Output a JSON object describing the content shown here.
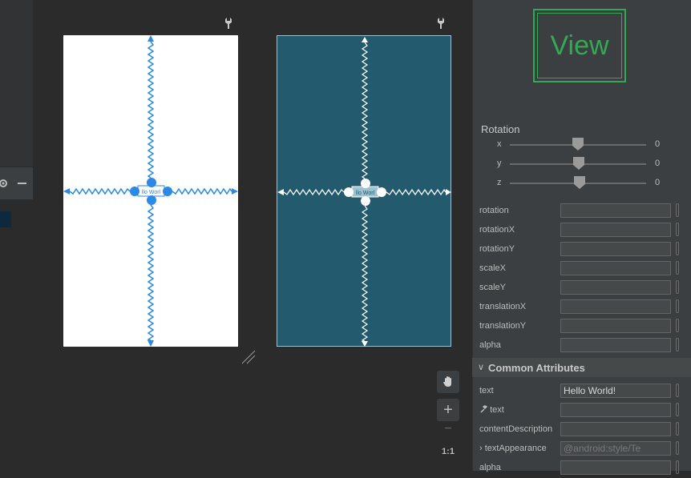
{
  "preview": {
    "view_label": "View",
    "rotation_title": "Rotation",
    "rotation_axes": [
      {
        "axis": "x",
        "value": "0",
        "slider_fraction": 0.5
      },
      {
        "axis": "y",
        "value": "0",
        "slider_fraction": 0.5
      },
      {
        "axis": "z",
        "value": "0",
        "slider_fraction": 0.51
      }
    ]
  },
  "transforms": [
    {
      "label": "rotation",
      "value": ""
    },
    {
      "label": "rotationX",
      "value": ""
    },
    {
      "label": "rotationY",
      "value": ""
    },
    {
      "label": "scaleX",
      "value": ""
    },
    {
      "label": "scaleY",
      "value": ""
    },
    {
      "label": "translationX",
      "value": ""
    },
    {
      "label": "translationY",
      "value": ""
    },
    {
      "label": "alpha",
      "value": ""
    }
  ],
  "common": {
    "section_title": "Common Attributes",
    "rows": [
      {
        "label": "text",
        "value": "Hello World!"
      },
      {
        "label": "text",
        "value": ""
      },
      {
        "label": "contentDescription",
        "value": ""
      },
      {
        "label": "textAppearance",
        "value": "@android:style/Te"
      },
      {
        "label": "alpha",
        "value": ""
      }
    ]
  },
  "canvas": {
    "textview_text": "llo Worl",
    "blueprint_text": "llo Worl"
  },
  "zoom": {
    "plus": "+",
    "minus": "−",
    "one_to_one": "1:1"
  },
  "colors": {
    "accent": "#2b8ae8",
    "view_green": "#34a853",
    "blueprint_bg": "#235a6e"
  }
}
